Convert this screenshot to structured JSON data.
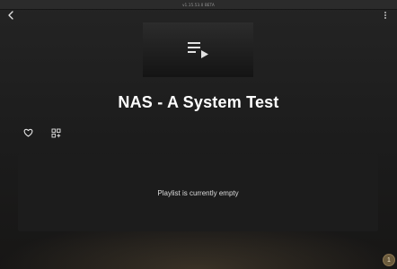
{
  "top_bar": {
    "version_text": "v1.15.53.0 BETA"
  },
  "header": {
    "back_icon": "chevron-left-icon",
    "menu_icon": "more-vertical-icon"
  },
  "playlist": {
    "cover_icon": "playlist-play-icon",
    "title": "NAS - A System Test",
    "actions": {
      "like_icon": "heart-icon",
      "add_icon": "grid-add-icon"
    },
    "empty_message": "Playlist is currently empty"
  },
  "badge": {
    "count": "1"
  }
}
